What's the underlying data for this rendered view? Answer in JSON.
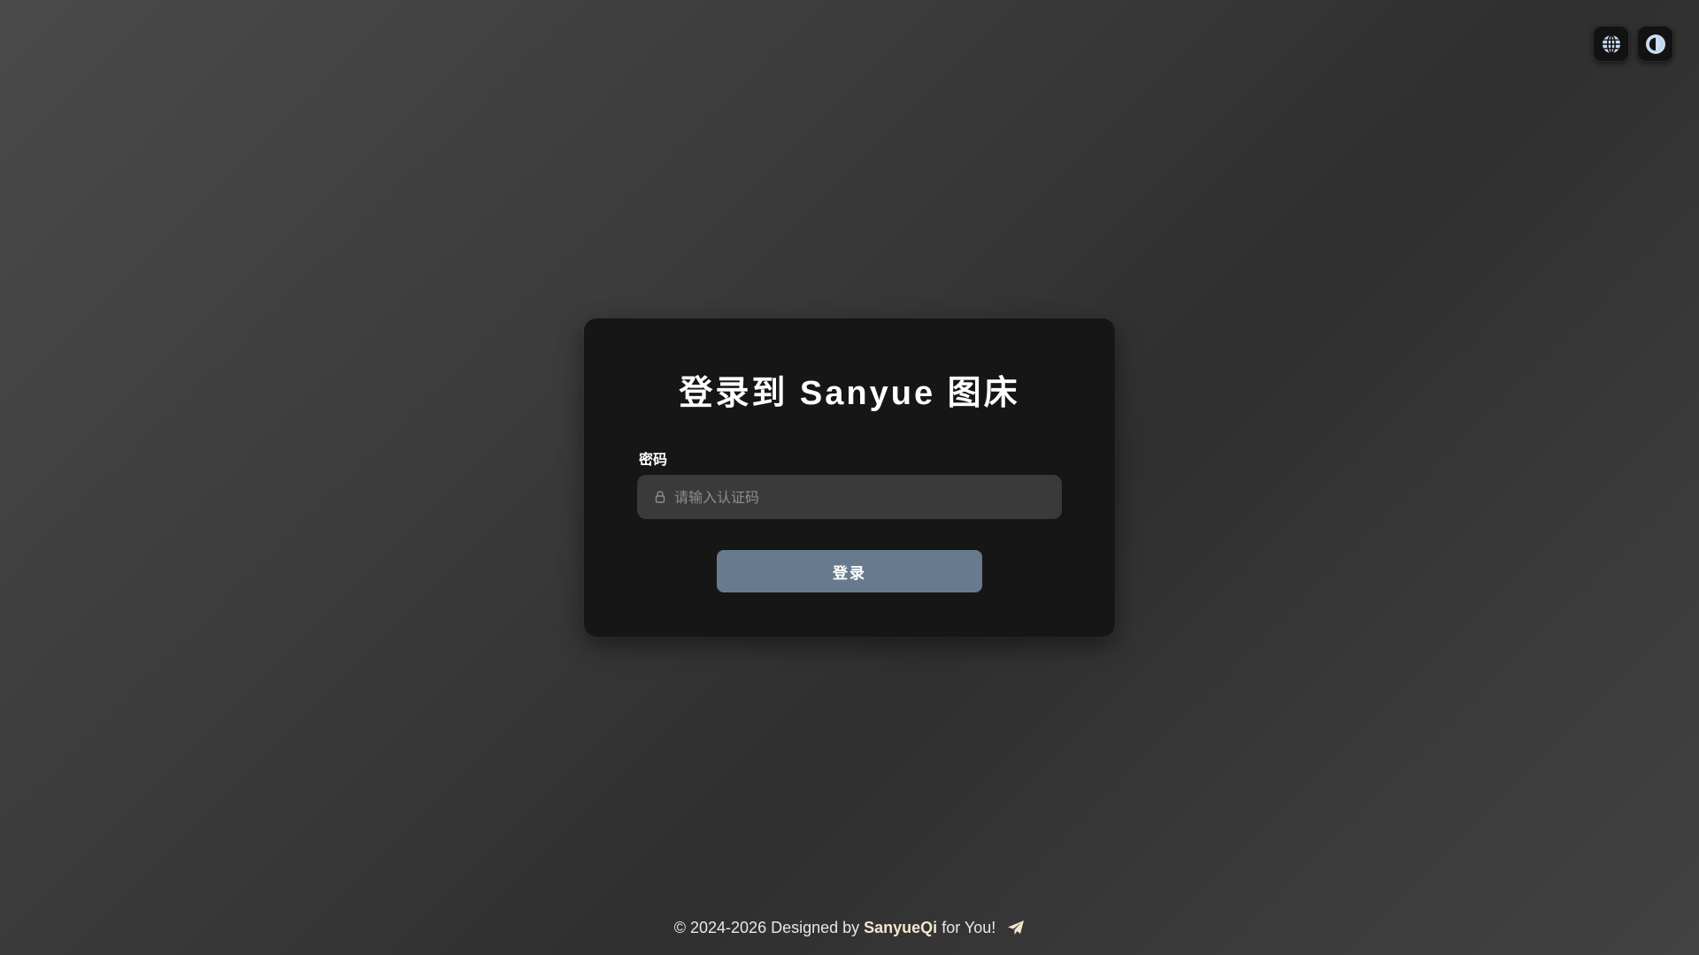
{
  "controls": {
    "language_icon": "globe-icon",
    "theme_icon": "contrast-icon",
    "icon_color": "#c9dcf5"
  },
  "login": {
    "title": "登录到 Sanyue 图床",
    "password_label": "密码",
    "password_placeholder": "请输入认证码",
    "password_value": "",
    "lock_icon": "lock-icon",
    "submit_label": "登录",
    "button_color": "#687a8d"
  },
  "footer": {
    "prefix": "© 2024-2026 Designed by ",
    "author": "SanyueQi",
    "suffix": " for You!",
    "icon": "paper-plane-icon",
    "author_color": "#f3e6cf"
  }
}
